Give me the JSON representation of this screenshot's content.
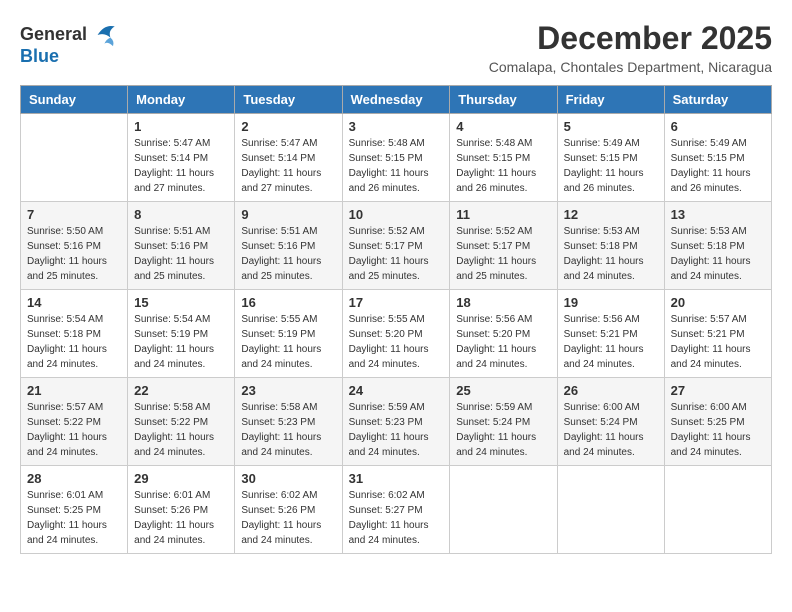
{
  "header": {
    "logo_line1": "General",
    "logo_line2": "Blue",
    "month_year": "December 2025",
    "location": "Comalapa, Chontales Department, Nicaragua"
  },
  "weekdays": [
    "Sunday",
    "Monday",
    "Tuesday",
    "Wednesday",
    "Thursday",
    "Friday",
    "Saturday"
  ],
  "weeks": [
    [
      {
        "day": "",
        "info": ""
      },
      {
        "day": "1",
        "info": "Sunrise: 5:47 AM\nSunset: 5:14 PM\nDaylight: 11 hours\nand 27 minutes."
      },
      {
        "day": "2",
        "info": "Sunrise: 5:47 AM\nSunset: 5:14 PM\nDaylight: 11 hours\nand 27 minutes."
      },
      {
        "day": "3",
        "info": "Sunrise: 5:48 AM\nSunset: 5:15 PM\nDaylight: 11 hours\nand 26 minutes."
      },
      {
        "day": "4",
        "info": "Sunrise: 5:48 AM\nSunset: 5:15 PM\nDaylight: 11 hours\nand 26 minutes."
      },
      {
        "day": "5",
        "info": "Sunrise: 5:49 AM\nSunset: 5:15 PM\nDaylight: 11 hours\nand 26 minutes."
      },
      {
        "day": "6",
        "info": "Sunrise: 5:49 AM\nSunset: 5:15 PM\nDaylight: 11 hours\nand 26 minutes."
      }
    ],
    [
      {
        "day": "7",
        "info": "Sunrise: 5:50 AM\nSunset: 5:16 PM\nDaylight: 11 hours\nand 25 minutes."
      },
      {
        "day": "8",
        "info": "Sunrise: 5:51 AM\nSunset: 5:16 PM\nDaylight: 11 hours\nand 25 minutes."
      },
      {
        "day": "9",
        "info": "Sunrise: 5:51 AM\nSunset: 5:16 PM\nDaylight: 11 hours\nand 25 minutes."
      },
      {
        "day": "10",
        "info": "Sunrise: 5:52 AM\nSunset: 5:17 PM\nDaylight: 11 hours\nand 25 minutes."
      },
      {
        "day": "11",
        "info": "Sunrise: 5:52 AM\nSunset: 5:17 PM\nDaylight: 11 hours\nand 25 minutes."
      },
      {
        "day": "12",
        "info": "Sunrise: 5:53 AM\nSunset: 5:18 PM\nDaylight: 11 hours\nand 24 minutes."
      },
      {
        "day": "13",
        "info": "Sunrise: 5:53 AM\nSunset: 5:18 PM\nDaylight: 11 hours\nand 24 minutes."
      }
    ],
    [
      {
        "day": "14",
        "info": "Sunrise: 5:54 AM\nSunset: 5:18 PM\nDaylight: 11 hours\nand 24 minutes."
      },
      {
        "day": "15",
        "info": "Sunrise: 5:54 AM\nSunset: 5:19 PM\nDaylight: 11 hours\nand 24 minutes."
      },
      {
        "day": "16",
        "info": "Sunrise: 5:55 AM\nSunset: 5:19 PM\nDaylight: 11 hours\nand 24 minutes."
      },
      {
        "day": "17",
        "info": "Sunrise: 5:55 AM\nSunset: 5:20 PM\nDaylight: 11 hours\nand 24 minutes."
      },
      {
        "day": "18",
        "info": "Sunrise: 5:56 AM\nSunset: 5:20 PM\nDaylight: 11 hours\nand 24 minutes."
      },
      {
        "day": "19",
        "info": "Sunrise: 5:56 AM\nSunset: 5:21 PM\nDaylight: 11 hours\nand 24 minutes."
      },
      {
        "day": "20",
        "info": "Sunrise: 5:57 AM\nSunset: 5:21 PM\nDaylight: 11 hours\nand 24 minutes."
      }
    ],
    [
      {
        "day": "21",
        "info": "Sunrise: 5:57 AM\nSunset: 5:22 PM\nDaylight: 11 hours\nand 24 minutes."
      },
      {
        "day": "22",
        "info": "Sunrise: 5:58 AM\nSunset: 5:22 PM\nDaylight: 11 hours\nand 24 minutes."
      },
      {
        "day": "23",
        "info": "Sunrise: 5:58 AM\nSunset: 5:23 PM\nDaylight: 11 hours\nand 24 minutes."
      },
      {
        "day": "24",
        "info": "Sunrise: 5:59 AM\nSunset: 5:23 PM\nDaylight: 11 hours\nand 24 minutes."
      },
      {
        "day": "25",
        "info": "Sunrise: 5:59 AM\nSunset: 5:24 PM\nDaylight: 11 hours\nand 24 minutes."
      },
      {
        "day": "26",
        "info": "Sunrise: 6:00 AM\nSunset: 5:24 PM\nDaylight: 11 hours\nand 24 minutes."
      },
      {
        "day": "27",
        "info": "Sunrise: 6:00 AM\nSunset: 5:25 PM\nDaylight: 11 hours\nand 24 minutes."
      }
    ],
    [
      {
        "day": "28",
        "info": "Sunrise: 6:01 AM\nSunset: 5:25 PM\nDaylight: 11 hours\nand 24 minutes."
      },
      {
        "day": "29",
        "info": "Sunrise: 6:01 AM\nSunset: 5:26 PM\nDaylight: 11 hours\nand 24 minutes."
      },
      {
        "day": "30",
        "info": "Sunrise: 6:02 AM\nSunset: 5:26 PM\nDaylight: 11 hours\nand 24 minutes."
      },
      {
        "day": "31",
        "info": "Sunrise: 6:02 AM\nSunset: 5:27 PM\nDaylight: 11 hours\nand 24 minutes."
      },
      {
        "day": "",
        "info": ""
      },
      {
        "day": "",
        "info": ""
      },
      {
        "day": "",
        "info": ""
      }
    ]
  ]
}
